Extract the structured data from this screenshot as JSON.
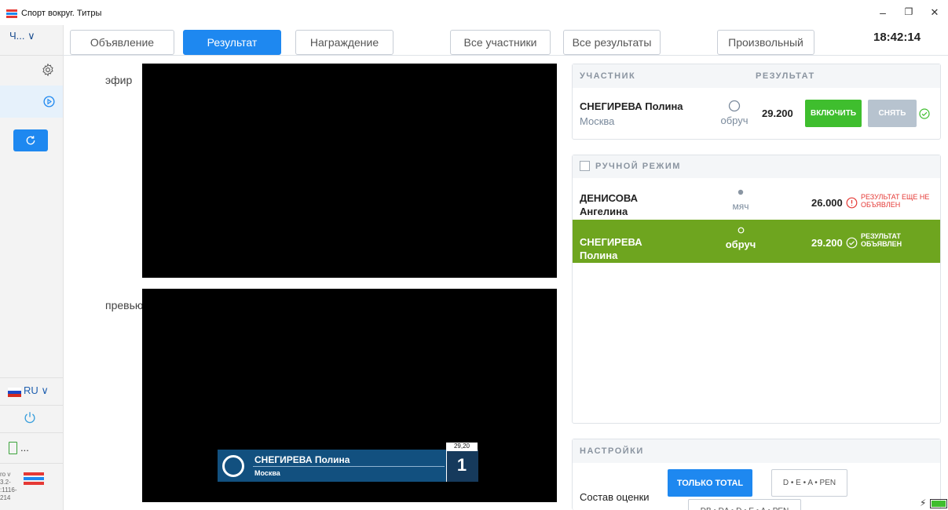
{
  "window": {
    "title": "Спорт вокруг. Титры",
    "logo_colors": [
      "#e53935",
      "#1e88f0",
      "#e53935"
    ],
    "minimize": "–",
    "maximize": "❐",
    "close": "✕"
  },
  "sidebar": {
    "channel": "Ч... ∨",
    "language": "RU ∨",
    "status_dots": "...",
    "version_lines": [
      "ro v",
      "3.2-",
      ":1116-",
      "214"
    ]
  },
  "tabs": [
    {
      "label": "Объявление",
      "active": false
    },
    {
      "label": "Результат",
      "active": true
    },
    {
      "label": "Награждение",
      "active": false
    },
    {
      "label": "Все участники",
      "active": false
    },
    {
      "label": "Все результаты",
      "active": false
    },
    {
      "label": "Произвольный",
      "active": false
    }
  ],
  "clock": "18:42:14",
  "video": {
    "air_label": "эфир",
    "preview_label": "превью",
    "lower_third": {
      "name": "СНЕГИРЕВА Полина",
      "city": "Москва",
      "score": "29,20",
      "place": "1"
    }
  },
  "participant_panel": {
    "header_participant": "УЧАСТНИК",
    "header_result": "РЕЗУЛЬТАТ",
    "name": "СНЕГИРЕВА Полина",
    "city": "Москва",
    "apparatus": "обруч",
    "result": "29.200",
    "on_button": "ВКЛЮЧИТЬ",
    "off_button": "СНЯТЬ"
  },
  "results_panel": {
    "manual_mode_label": "РУЧНОЙ РЕЖИМ",
    "manual_mode_checked": false,
    "rows": [
      {
        "name_line1": "ДЕНИСОВА",
        "name_line2": "Ангелина",
        "apparatus": "мяч",
        "result": "26.000",
        "status_line1": "РЕЗУЛЬТАТ ЕЩЕ НЕ",
        "status_line2": "ОБЪЯВЛЕН",
        "announced": false
      },
      {
        "name_line1": "СНЕГИРЕВА",
        "name_line2": "Полина",
        "apparatus": "обруч",
        "result": "29.200",
        "status_line1": "РЕЗУЛЬТАТ",
        "status_line2": "ОБЪЯВЛЕН",
        "announced": true
      }
    ]
  },
  "settings_panel": {
    "header": "НАСТРОЙКИ",
    "score_composition_label": "Состав оценки",
    "option_total": "ТОЛЬКО TOTAL",
    "option_deapen": "D • E • A • PEN",
    "option_detailed": "DB • DA • D • E • A • PEN"
  },
  "colors": {
    "accent_blue": "#1e88f0",
    "green": "#3fbe2e",
    "row_highlight": "#6ea51f",
    "error_red": "#e53935",
    "lower_third_blue": "#12507f"
  }
}
